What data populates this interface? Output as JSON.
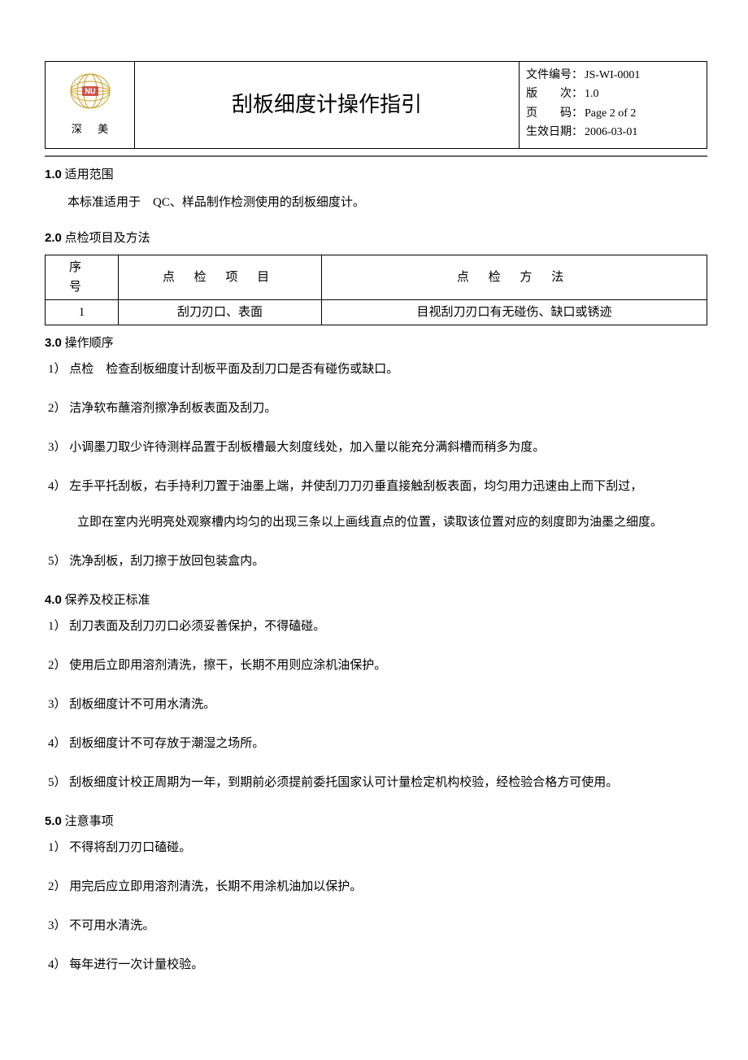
{
  "header": {
    "brand": "深 美",
    "title": "刮板细度计操作指引",
    "meta": {
      "doc_no_label": "文件编号：",
      "doc_no": "JS-WI-0001",
      "ver_label": "版　　次：",
      "ver": "1.0",
      "page_label": "页　　码：",
      "page": "Page 2 of 2",
      "eff_label": "生效日期：",
      "eff": "2006-03-01"
    }
  },
  "s1": {
    "num": "1.0",
    "title": " 适用范围",
    "body": "本标准适用于　QC、样品制作检测使用的刮板细度计。"
  },
  "s2": {
    "num": "2.0",
    "title": " 点检项目及方法",
    "th_seq": "序　号",
    "th_item": "点 检 项 目",
    "th_method": "点 检 方 法",
    "row": {
      "seq": "1",
      "item": "刮刀刃口、表面",
      "method": "目视刮刀刃口有无碰伤、缺口或锈迹"
    }
  },
  "s3": {
    "num": "3.0",
    "title": " 操作顺序",
    "items": {
      "i1": "1）  点检　检查刮板细度计刮板平面及刮刀口是否有碰伤或缺口。",
      "i2": "2）  洁净软布蘸溶剂擦净刮板表面及刮刀。",
      "i3": "3）  小调墨刀取少许待测样品置于刮板槽最大刻度线处，加入量以能充分满斜槽而稍多为度。",
      "i4a": "4）  左手平托刮板，右手持利刀置于油墨上端，并使刮刀刀刃垂直接触刮板表面，均匀用力迅速由上而下刮过，",
      "i4b": "立即在室内光明亮处观察槽内均匀的出现三条以上画线直点的位置，读取该位置对应的刻度即为油墨之细度。",
      "i5": "5）  洗净刮板，刮刀擦于放回包装盒内。"
    }
  },
  "s4": {
    "num": "4.0",
    "title": " 保养及校正标准",
    "items": {
      "i1": "1）  刮刀表面及刮刀刃口必须妥善保护，不得磕碰。",
      "i2": "2）  使用后立即用溶剂清洗，擦干，长期不用则应涂机油保护。",
      "i3": "3）  刮板细度计不可用水清洗。",
      "i4": "4）  刮板细度计不可存放于潮湿之场所。",
      "i5": "5）  刮板细度计校正周期为一年，到期前必须提前委托国家认可计量检定机构校验，经检验合格方可使用。"
    }
  },
  "s5": {
    "num": "5.0",
    "title": " 注意事项",
    "items": {
      "i1": "1）  不得将刮刀刃口磕碰。",
      "i2": "2）  用完后应立即用溶剂清洗，长期不用涂机油加以保护。",
      "i3": "3）  不可用水清洗。",
      "i4": "4）  每年进行一次计量校验。"
    }
  }
}
